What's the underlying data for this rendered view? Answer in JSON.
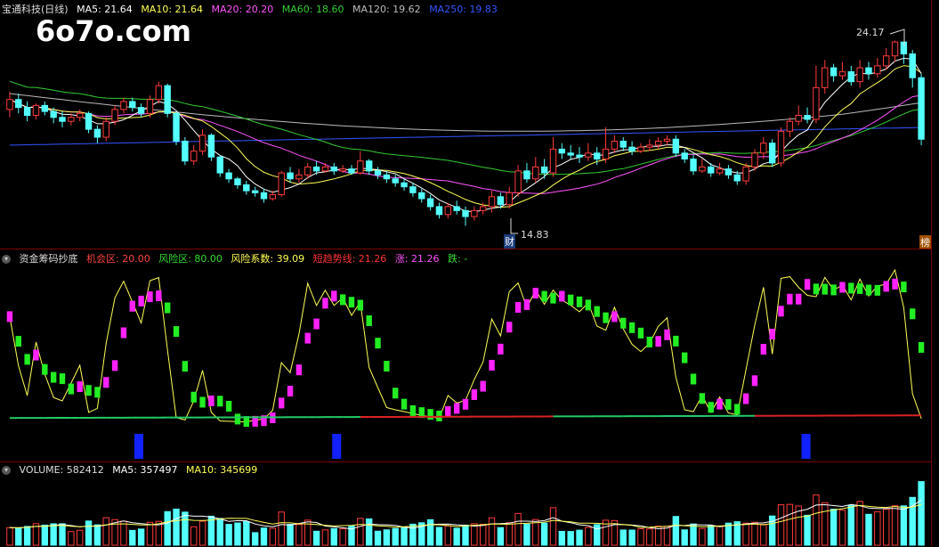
{
  "main": {
    "title": "宝通科技(日线)",
    "ma5": "MA5: 21.64",
    "ma10": "MA10: 21.64",
    "ma20": "MA20: 20.20",
    "ma60": "MA60: 18.60",
    "ma120": "MA120: 19.62",
    "ma250": "MA250: 19.83",
    "high_label": "24.17",
    "low_label": "14.83",
    "fin_tag": "财",
    "right_tag": "榜"
  },
  "indicator": {
    "title": "资金筹码抄底",
    "chance": "机会区: 20.00",
    "risk": "风险区: 80.00",
    "coef": "风险系数: 39.09",
    "trend": "短趋势线: 21.26",
    "up": "涨: 21.26",
    "down": "跌: -"
  },
  "volume": {
    "title": "VOLUME: 582412",
    "ma5": "MA5: 357497",
    "ma10": "MA10: 345699"
  },
  "watermark": "6o7o.com",
  "colors": {
    "up": "#ff3b3b",
    "down": "#54ffff",
    "ma5": "#ffffff",
    "ma10": "#ffff55",
    "ma20": "#ff55ff",
    "ma60": "#33cc33",
    "ma120": "#bbbbbb",
    "ma250": "#3355ff",
    "pink": "#ff22ff",
    "green": "#22ee22"
  },
  "chart_data": {
    "type": "candlestick",
    "price_range": [
      14.0,
      25.5
    ],
    "high": 24.17,
    "low": 14.83,
    "candles": [
      [
        20.7,
        21.2,
        21.6,
        20.3
      ],
      [
        21.2,
        20.8,
        21.5,
        20.5
      ],
      [
        20.8,
        20.4,
        21.1,
        20.1
      ],
      [
        20.4,
        20.9,
        21.0,
        20.2
      ],
      [
        20.9,
        20.6,
        21.1,
        20.4
      ],
      [
        20.6,
        20.3,
        20.8,
        20.0
      ],
      [
        20.3,
        20.1,
        20.6,
        19.8
      ],
      [
        20.1,
        20.3,
        20.5,
        19.9
      ],
      [
        20.3,
        20.5,
        20.7,
        20.1
      ],
      [
        20.5,
        19.7,
        20.6,
        19.5
      ],
      [
        19.7,
        19.3,
        19.9,
        19.0
      ],
      [
        19.3,
        20.1,
        20.3,
        19.1
      ],
      [
        20.1,
        20.7,
        20.9,
        19.9
      ],
      [
        20.7,
        21.1,
        21.3,
        20.5
      ],
      [
        21.1,
        20.8,
        21.3,
        20.6
      ],
      [
        20.8,
        20.5,
        21.0,
        20.3
      ],
      [
        20.5,
        21.2,
        21.4,
        20.3
      ],
      [
        21.2,
        21.9,
        22.1,
        21.0
      ],
      [
        21.9,
        20.5,
        22.0,
        20.3
      ],
      [
        20.5,
        19.1,
        20.6,
        18.9
      ],
      [
        19.1,
        18.1,
        19.3,
        17.9
      ],
      [
        18.1,
        18.6,
        18.9,
        17.9
      ],
      [
        18.6,
        19.4,
        19.7,
        18.4
      ],
      [
        19.4,
        18.3,
        19.5,
        18.1
      ],
      [
        18.3,
        17.5,
        18.4,
        17.3
      ],
      [
        17.5,
        17.2,
        17.7,
        17.0
      ],
      [
        17.2,
        16.9,
        17.3,
        16.7
      ],
      [
        16.9,
        16.6,
        17.1,
        16.4
      ],
      [
        16.6,
        16.5,
        16.8,
        16.3
      ],
      [
        16.5,
        16.2,
        16.7,
        16.0
      ],
      [
        16.2,
        16.4,
        16.6,
        16.1
      ],
      [
        16.4,
        17.5,
        17.6,
        16.3
      ],
      [
        17.5,
        17.2,
        17.8,
        17.0
      ],
      [
        17.2,
        17.4,
        17.7,
        17.0
      ],
      [
        17.4,
        17.8,
        18.0,
        17.2
      ],
      [
        17.8,
        17.6,
        18.1,
        17.4
      ],
      [
        17.6,
        17.8,
        18.0,
        17.5
      ],
      [
        17.8,
        17.6,
        18.0,
        17.4
      ],
      [
        17.6,
        17.7,
        17.9,
        17.5
      ],
      [
        17.7,
        17.5,
        17.9,
        17.4
      ],
      [
        17.5,
        18.1,
        18.6,
        17.4
      ],
      [
        18.1,
        17.6,
        18.2,
        17.4
      ],
      [
        17.6,
        17.4,
        17.8,
        17.2
      ],
      [
        17.4,
        17.2,
        17.6,
        17.0
      ],
      [
        17.2,
        17.0,
        17.4,
        16.8
      ],
      [
        17.0,
        16.8,
        17.2,
        16.6
      ],
      [
        16.8,
        16.5,
        17.0,
        16.3
      ],
      [
        16.5,
        16.2,
        16.7,
        16.0
      ],
      [
        16.2,
        15.8,
        16.4,
        15.6
      ],
      [
        15.8,
        15.4,
        16.0,
        15.2
      ],
      [
        15.4,
        15.8,
        16.0,
        15.2
      ],
      [
        15.8,
        15.6,
        16.1,
        15.4
      ],
      [
        15.6,
        15.3,
        15.8,
        14.83
      ],
      [
        15.3,
        15.6,
        15.8,
        15.1
      ],
      [
        15.6,
        15.8,
        16.0,
        15.4
      ],
      [
        15.8,
        16.3,
        16.6,
        15.5
      ],
      [
        16.3,
        15.9,
        16.5,
        15.7
      ],
      [
        15.9,
        16.5,
        16.8,
        15.7
      ],
      [
        16.5,
        17.6,
        17.9,
        16.3
      ],
      [
        17.6,
        17.2,
        18.0,
        17.0
      ],
      [
        17.2,
        17.8,
        18.3,
        17.0
      ],
      [
        17.8,
        17.5,
        18.2,
        17.2
      ],
      [
        17.5,
        18.7,
        19.3,
        17.3
      ],
      [
        18.7,
        18.5,
        19.0,
        18.2
      ],
      [
        18.5,
        18.4,
        18.9,
        18.2
      ],
      [
        18.4,
        18.3,
        18.8,
        18.0
      ],
      [
        18.3,
        18.5,
        19.0,
        18.1
      ],
      [
        18.5,
        18.2,
        18.8,
        17.9
      ],
      [
        18.2,
        18.7,
        19.8,
        18.0
      ],
      [
        18.7,
        19.1,
        19.4,
        18.5
      ],
      [
        19.1,
        18.8,
        19.3,
        18.6
      ],
      [
        18.8,
        18.6,
        19.1,
        18.4
      ],
      [
        18.6,
        18.8,
        19.0,
        18.5
      ],
      [
        18.8,
        18.9,
        19.2,
        18.6
      ],
      [
        18.9,
        19.1,
        19.3,
        18.7
      ],
      [
        19.1,
        19.2,
        19.4,
        18.9
      ],
      [
        19.2,
        18.5,
        19.4,
        18.3
      ],
      [
        18.5,
        18.2,
        18.7,
        18.0
      ],
      [
        18.2,
        17.6,
        18.4,
        17.4
      ],
      [
        17.6,
        17.8,
        18.2,
        17.5
      ],
      [
        17.8,
        17.5,
        18.0,
        17.3
      ],
      [
        17.5,
        17.7,
        18.0,
        17.4
      ],
      [
        17.7,
        17.4,
        17.9,
        17.2
      ],
      [
        17.4,
        17.1,
        17.6,
        16.9
      ],
      [
        17.1,
        17.8,
        18.0,
        16.9
      ],
      [
        17.8,
        18.5,
        18.7,
        17.6
      ],
      [
        18.5,
        19.0,
        19.3,
        18.2
      ],
      [
        19.0,
        18.0,
        19.2,
        17.8
      ],
      [
        18.0,
        19.6,
        19.8,
        17.8
      ],
      [
        19.6,
        20.1,
        20.3,
        19.3
      ],
      [
        20.1,
        20.4,
        20.9,
        19.9
      ],
      [
        20.4,
        20.2,
        20.8,
        20.0
      ],
      [
        20.2,
        21.8,
        22.9,
        20.0
      ],
      [
        21.8,
        22.8,
        23.2,
        21.5
      ],
      [
        22.8,
        22.4,
        23.0,
        22.1
      ],
      [
        22.4,
        22.6,
        23.1,
        22.2
      ],
      [
        22.6,
        22.1,
        22.9,
        21.9
      ],
      [
        22.1,
        22.8,
        23.2,
        21.8
      ],
      [
        22.8,
        22.5,
        23.1,
        22.2
      ],
      [
        22.5,
        22.9,
        23.3,
        22.3
      ],
      [
        22.9,
        23.4,
        23.8,
        22.7
      ],
      [
        23.4,
        24.1,
        24.17,
        23.1
      ],
      [
        24.1,
        23.5,
        24.1,
        23.0
      ],
      [
        23.5,
        22.3,
        23.7,
        21.8
      ],
      [
        22.3,
        19.2,
        22.5,
        18.9
      ]
    ],
    "indicator_range": [
      0,
      100
    ],
    "chance_level": 20.0,
    "risk_level": 80.0,
    "coef": 39.09,
    "volume_ma5": 357497,
    "volume_ma10": 345699,
    "last_volume": 582412
  }
}
